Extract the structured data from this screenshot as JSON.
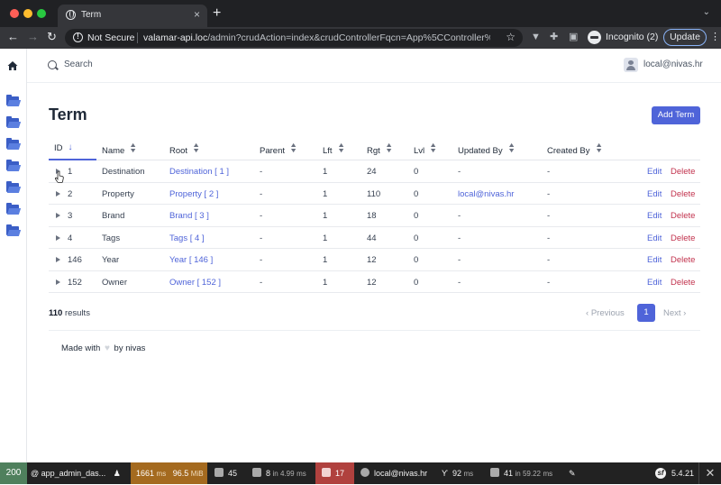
{
  "browser": {
    "tab_title": "Term",
    "url_host": "valamar-api.loc",
    "url_path": "/admin?crudAction=index&crudControllerFqcn=App%5CController%5...",
    "security_label": "Not Secure",
    "incognito_label": "Incognito (2)",
    "update_label": "Update"
  },
  "header": {
    "search_placeholder": "Search",
    "user_name": "local@nivas.hr"
  },
  "page": {
    "title": "Term",
    "add_button": "Add Term"
  },
  "table": {
    "columns": [
      "ID",
      "Name",
      "Root",
      "Parent",
      "Lft",
      "Rgt",
      "Lvl",
      "Updated By",
      "Created By"
    ],
    "sorted_column": "ID",
    "rows": [
      {
        "id": "1",
        "name": "Destination",
        "root": "Destination [ 1 ]",
        "parent": "-",
        "lft": "1",
        "rgt": "24",
        "lvl": "0",
        "updated_by": "-",
        "created_by": "-"
      },
      {
        "id": "2",
        "name": "Property",
        "root": "Property [ 2 ]",
        "parent": "-",
        "lft": "1",
        "rgt": "110",
        "lvl": "0",
        "updated_by": "local@nivas.hr",
        "created_by": "-"
      },
      {
        "id": "3",
        "name": "Brand",
        "root": "Brand [ 3 ]",
        "parent": "-",
        "lft": "1",
        "rgt": "18",
        "lvl": "0",
        "updated_by": "-",
        "created_by": "-"
      },
      {
        "id": "4",
        "name": "Tags",
        "root": "Tags [ 4 ]",
        "parent": "-",
        "lft": "1",
        "rgt": "44",
        "lvl": "0",
        "updated_by": "-",
        "created_by": "-"
      },
      {
        "id": "146",
        "name": "Year",
        "root": "Year [ 146 ]",
        "parent": "-",
        "lft": "1",
        "rgt": "12",
        "lvl": "0",
        "updated_by": "-",
        "created_by": "-"
      },
      {
        "id": "152",
        "name": "Owner",
        "root": "Owner [ 152 ]",
        "parent": "-",
        "lft": "1",
        "rgt": "12",
        "lvl": "0",
        "updated_by": "-",
        "created_by": "-"
      }
    ],
    "action_edit": "Edit",
    "action_delete": "Delete"
  },
  "pagination": {
    "results_count": "110",
    "results_label": " results",
    "previous": "Previous",
    "current_page": "1",
    "next": "Next"
  },
  "footer": {
    "made_with": "Made with",
    "by": "by nivas"
  },
  "debug_toolbar": {
    "status": "200",
    "route": "@ app_admin_das...",
    "time": "1661",
    "time_unit": "ms",
    "memory": "96.5",
    "memory_unit": "MiB",
    "forms": "45",
    "cache": "8",
    "cache_detail": "in 4.99",
    "cache_unit": "ms",
    "security_count": "17",
    "user": "local@nivas.hr",
    "twig_time": "92",
    "twig_unit": "ms",
    "db_queries": "41",
    "db_detail": "in 59.22",
    "db_unit": "ms",
    "version": "5.4.21"
  },
  "colors": {
    "accent": "#4f64d9",
    "danger": "#c2334e",
    "status_ok": "#4f805d",
    "perf": "#a46a1f",
    "warn": "#b0413e"
  },
  "icons": [
    "home-icon",
    "folder-open-icon",
    "search-icon",
    "user-avatar-icon",
    "sort-icon",
    "caret-right-icon",
    "heart-icon",
    "symfony-icon",
    "close-icon"
  ]
}
